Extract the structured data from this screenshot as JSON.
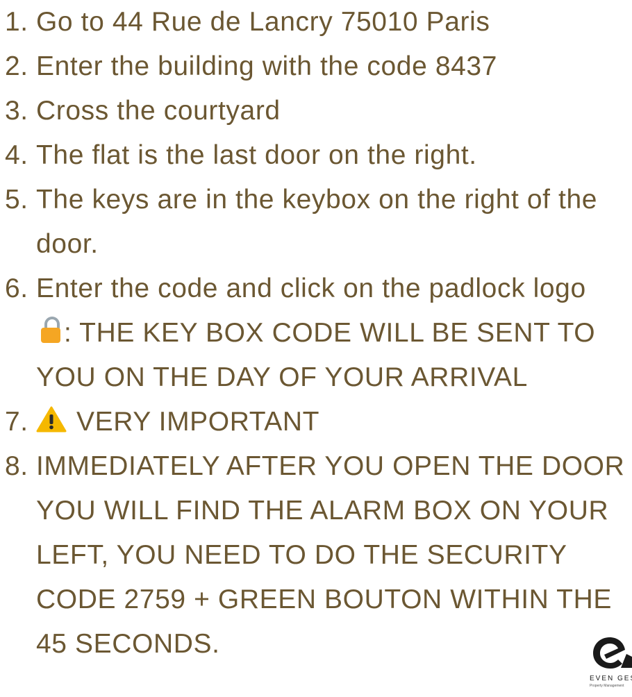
{
  "steps": [
    {
      "number": "1.",
      "text": "Go to 44 Rue de Lancry 75010 Paris"
    },
    {
      "number": "2.",
      "text": "Enter the building with the code 8437"
    },
    {
      "number": "3.",
      "text": "Cross the courtyard"
    },
    {
      "number": "4.",
      "text": "The flat is the last door on the right."
    },
    {
      "number": "5.",
      "text": "The keys are in the keybox on the right of the door."
    },
    {
      "number": "6.",
      "text_before_icon": "Enter the code and click on the padlock logo",
      "icon": "padlock-icon",
      "text_after_icon": ": THE KEY BOX CODE WILL BE SENT TO YOU ON THE DAY OF YOUR ARRIVAL"
    },
    {
      "number": "7.",
      "icon": "warning-icon",
      "text": "VERY IMPORTANT"
    },
    {
      "number": "8.",
      "text": "IMMEDIATELY AFTER YOU OPEN THE DOOR YOU WILL FIND THE ALARM BOX ON YOUR LEFT, YOU NEED TO DO THE SECURITY CODE 2759 + GREEN BOUTON WITHIN THE 45 SECONDS."
    }
  ],
  "logo": {
    "name": "EVEN GEST",
    "tagline": "Property Management"
  },
  "colors": {
    "text": "#6b5732",
    "padlock_body": "#f5a623",
    "padlock_shackle": "#9aa7b0",
    "warning_fill": "#f5b800",
    "logo": "#1a1a1a"
  }
}
